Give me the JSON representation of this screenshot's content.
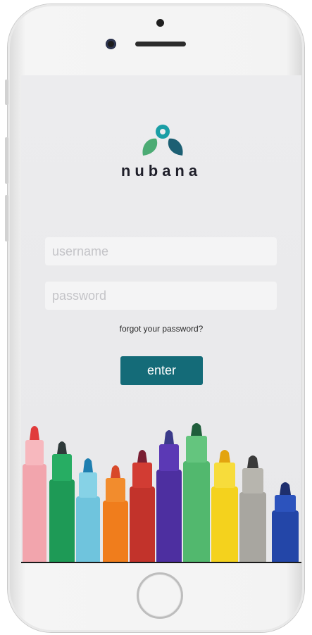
{
  "app": {
    "brand": "nubana"
  },
  "login": {
    "username_placeholder": "username",
    "password_placeholder": "password",
    "forgot_label": "forgot your password?",
    "enter_label": "enter"
  },
  "colors": {
    "accent": "#146b78",
    "logo_teal": "#1a9ea5",
    "logo_green": "#4cab74",
    "logo_dark": "#1c5f73"
  },
  "decoration": {
    "image": "felt-tip markers row"
  }
}
